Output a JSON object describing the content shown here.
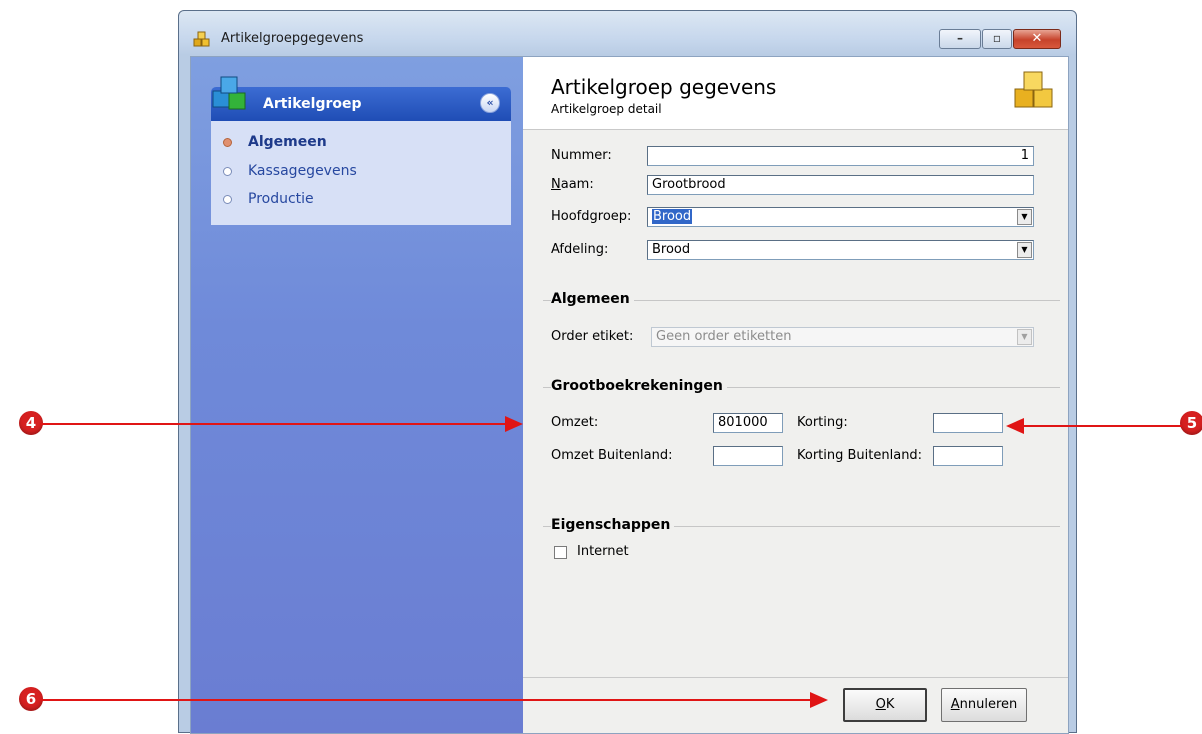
{
  "window": {
    "title": "Artikelgroepgegevens",
    "min_icon": "minimize-icon",
    "max_icon": "maximize-icon",
    "close_icon": "close-icon"
  },
  "sidebar": {
    "panel_title": "Artikelgroep",
    "collapse_glyph": "«",
    "items": [
      {
        "label": "Algemeen",
        "active": true
      },
      {
        "label": "Kassagegevens",
        "active": false
      },
      {
        "label": "Productie",
        "active": false
      }
    ]
  },
  "header": {
    "title": "Artikelgroep gegevens",
    "subtitle": "Artikelgroep detail"
  },
  "form": {
    "nummer_label": "Nummer:",
    "nummer_value": "1",
    "naam_label_first": "N",
    "naam_label_rest": "aam:",
    "naam_value": "Grootbrood",
    "hoofdgroep_label": "Hoofdgroep:",
    "hoofdgroep_value": "Brood",
    "afdeling_label": "Afdeling:",
    "afdeling_value": "Brood"
  },
  "algemeen": {
    "group_title": "Algemeen",
    "order_etiket_label": "Order etiket:",
    "order_etiket_value": "Geen order etiketten"
  },
  "grootboek": {
    "group_title": "Grootboekrekeningen",
    "omzet_label": "Omzet:",
    "omzet_value": "801000",
    "korting_label": "Korting:",
    "korting_value": "",
    "omzet_buitenland_label": "Omzet Buitenland:",
    "omzet_buitenland_value": "",
    "korting_buitenland_label": "Korting Buitenland:",
    "korting_buitenland_value": ""
  },
  "eigenschappen": {
    "group_title": "Eigenschappen",
    "internet_label": "Internet",
    "internet_checked": false
  },
  "buttons": {
    "ok_first": "O",
    "ok_rest": "K",
    "cancel_first": "A",
    "cancel_rest": "nnuleren"
  },
  "callouts": [
    "4",
    "5",
    "6"
  ],
  "colors": {
    "sidebar_top": "#7f9fe0",
    "panel_header": "#1f4db5",
    "callout_red": "#d62020",
    "selection_blue": "#3167c8"
  }
}
